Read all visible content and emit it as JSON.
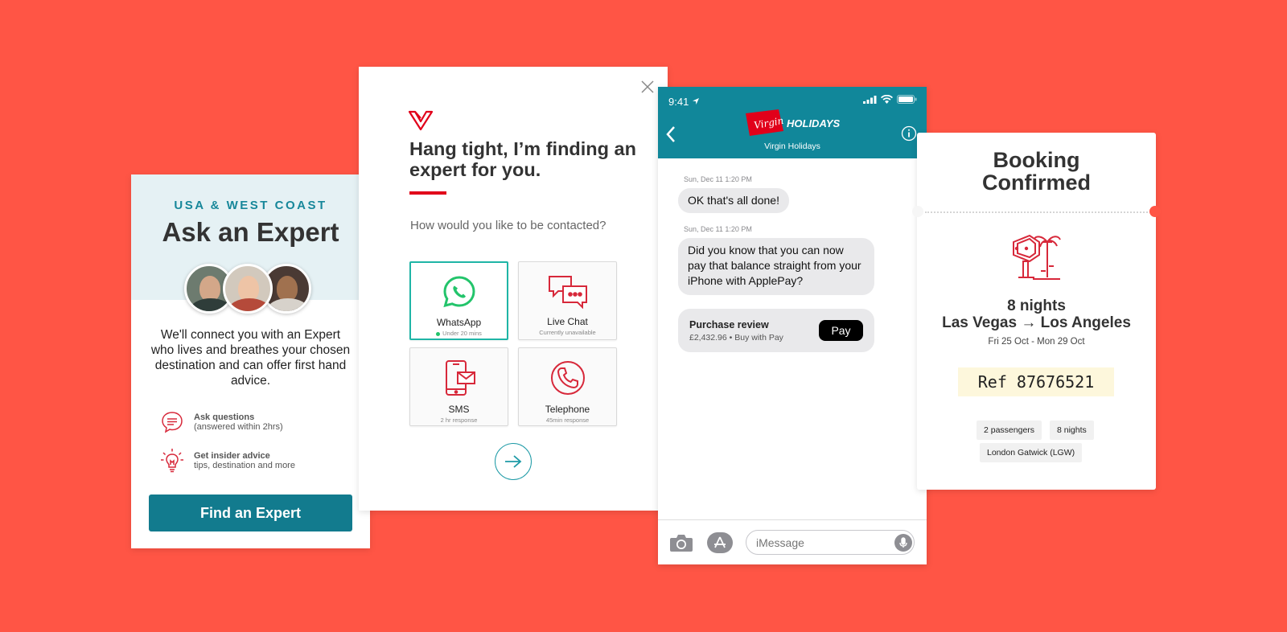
{
  "expert_card": {
    "region": "USA & WEST COAST",
    "title": "Ask an Expert",
    "description": "We'll connect you with an Expert who lives and breathes your chosen destination and can offer first hand advice.",
    "features": [
      {
        "title": "Ask questions",
        "subtitle": "(answered within 2hrs)",
        "icon": "speech-bubble-icon"
      },
      {
        "title": "Get insider advice",
        "subtitle": "tips, destination and more",
        "icon": "lightbulb-icon"
      }
    ],
    "button_label": "Find an Expert"
  },
  "contact_card": {
    "headline": "Hang tight, I’m finding an expert for you.",
    "question": "How would you like to be contacted?",
    "options": [
      {
        "label": "WhatsApp",
        "sub": "Under 20 mins",
        "icon": "whatsapp-icon",
        "selected": true
      },
      {
        "label": "Live Chat",
        "sub": "Currently unavailable",
        "icon": "chat-bubbles-icon",
        "selected": false
      },
      {
        "label": "SMS",
        "sub": "2 hr response",
        "icon": "mobile-message-icon",
        "selected": false
      },
      {
        "label": "Telephone",
        "sub": "45min response",
        "icon": "telephone-icon",
        "selected": false
      }
    ]
  },
  "phone": {
    "time": "9:41",
    "brand_logo": "Virgin",
    "brand_text": "HOLIDAYS",
    "contact_name": "Virgin Holidays",
    "messages": [
      {
        "timestamp": "Sun, Dec 11 1:20 PM",
        "text": "OK that's all done!"
      },
      {
        "timestamp": "Sun, Dec 11 1:20 PM",
        "text": "Did you know that you can now pay that balance straight from your iPhone with ApplePay?"
      }
    ],
    "payment": {
      "title": "Purchase review",
      "detail": "£2,432.96 • Buy with  Pay",
      "button": " Pay"
    },
    "input_placeholder": "iMessage"
  },
  "booking": {
    "title_line1": "Booking",
    "title_line2": "Confirmed",
    "nights": "8 nights",
    "route": "Las Vegas → Los Angeles",
    "dates": "Fri 25 Oct - Mon 29 Oct",
    "reference": "Ref 87676521",
    "tags": [
      "2 passengers",
      "8 nights",
      "London Gatwick (LGW)"
    ]
  },
  "colors": {
    "background": "#ff5545",
    "teal": "#127b8e",
    "virgin_red": "#e1001a",
    "whatsapp_green": "#23c46b"
  }
}
